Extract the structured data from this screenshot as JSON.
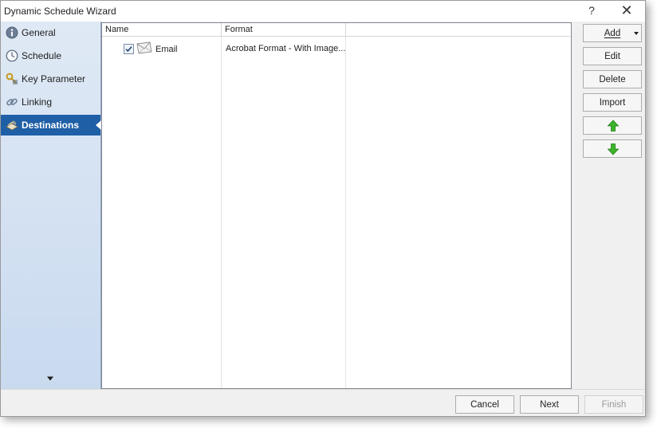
{
  "window": {
    "title": "Dynamic Schedule Wizard",
    "help": "?",
    "close": "✕"
  },
  "sidebar": {
    "items": [
      {
        "label": "General",
        "icon": "info-icon"
      },
      {
        "label": "Schedule",
        "icon": "clock-icon"
      },
      {
        "label": "Key Parameter",
        "icon": "key-icon"
      },
      {
        "label": "Linking",
        "icon": "link-icon"
      },
      {
        "label": "Destinations",
        "icon": "destination-icon",
        "active": true
      }
    ],
    "scroll_down": "chevron-down-icon"
  },
  "list": {
    "columns": [
      "Name",
      "Format",
      ""
    ],
    "rows": [
      {
        "checked": true,
        "icon": "envelope-icon",
        "name": "Email",
        "format": "Acrobat Format - With Image..."
      }
    ]
  },
  "actions": {
    "add": "Add",
    "edit": "Edit",
    "delete": "Delete",
    "import": "Import",
    "move_up": "arrow-up-icon",
    "move_down": "arrow-down-icon"
  },
  "footer": {
    "cancel": "Cancel",
    "next": "Next",
    "finish": "Finish"
  },
  "colors": {
    "accent": "#1f5fa6",
    "arrow_green": "#3cb52a"
  }
}
